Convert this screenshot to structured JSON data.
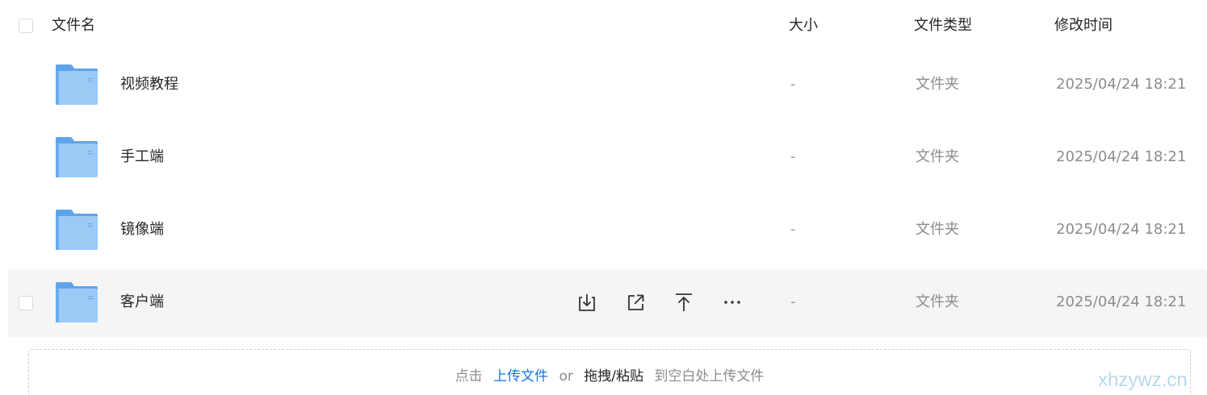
{
  "header": {
    "name": "文件名",
    "size": "大小",
    "type": "文件类型",
    "mtime": "修改时间"
  },
  "rows": [
    {
      "name": "视频教程",
      "size": "-",
      "type": "文件夹",
      "mtime": "2025/04/24 18:21"
    },
    {
      "name": "手工端",
      "size": "-",
      "type": "文件夹",
      "mtime": "2025/04/24 18:21"
    },
    {
      "name": "镜像端",
      "size": "-",
      "type": "文件夹",
      "mtime": "2025/04/24 18:21"
    },
    {
      "name": "客户端",
      "size": "-",
      "type": "文件夹",
      "mtime": "2025/04/24 18:21"
    }
  ],
  "icons": {
    "folder": "folder-icon",
    "download": "download-icon",
    "share": "share-icon",
    "top": "pin-top-icon",
    "more": "more-icon"
  },
  "colors": {
    "folder": "#7fb5ee",
    "link": "#1a73e8"
  },
  "dropzone": {
    "click": "点击",
    "upload_link": "上传文件",
    "or": "or",
    "drag_paste": "拖拽/粘贴",
    "to_blank": "到空白处上传文件"
  },
  "watermark": "xhzywz.cn"
}
